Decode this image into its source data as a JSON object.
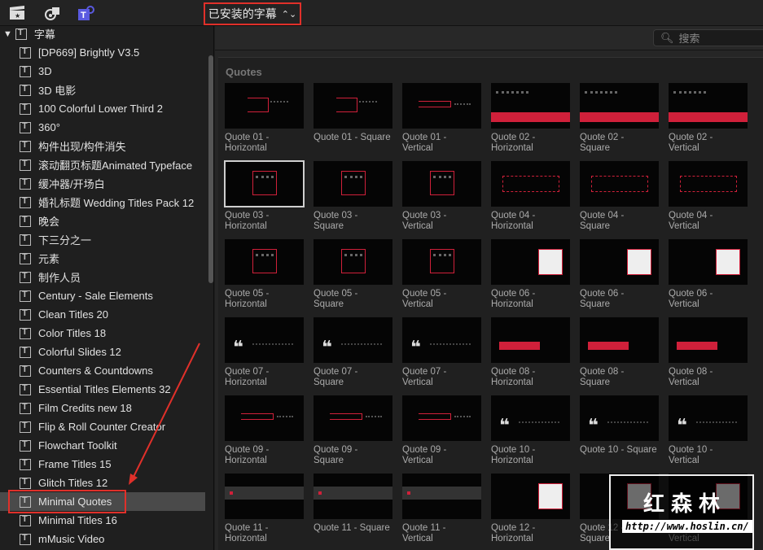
{
  "toolbar": {
    "picker_label": "已安装的字幕",
    "icons": [
      "clapper-icon",
      "music-photo-icon",
      "titles-icon"
    ]
  },
  "sidebar": {
    "root": "字幕",
    "items": [
      "[DP669] Brightly V3.5",
      "3D",
      "3D 电影",
      "100 Colorful Lower Third 2",
      "360°",
      "构件出现/构件消失",
      "滚动翻页标题Animated Typeface",
      "缓冲器/开场白",
      "婚礼标题 Wedding Titles Pack 12",
      "晚会",
      "下三分之一",
      "元素",
      "制作人员",
      "Century - Sale Elements",
      "Clean Titles 20",
      "Color Titles 18",
      "Colorful Slides 12",
      "Counters & Countdowns",
      "Essential Titles Elements 32",
      "Film Credits new 18",
      "Flip & Roll Counter Creator",
      "Flowchart Toolkit",
      "Frame Titles 15",
      "Glitch Titles 12",
      "Minimal Quotes",
      "Minimal Titles 16",
      "mMusic Video"
    ],
    "selected_index": 24
  },
  "search": {
    "placeholder": "搜索"
  },
  "browser": {
    "section": "Quotes",
    "items": [
      {
        "title": "Quote 01 -\nHorizontal",
        "thumb": "frame"
      },
      {
        "title": "Quote 01 - Square",
        "thumb": "frame"
      },
      {
        "title": "Quote 01 -\nVertical",
        "thumb": "line"
      },
      {
        "title": "Quote 02 -\nHorizontal",
        "thumb": "bar"
      },
      {
        "title": "Quote 02 -\nSquare",
        "thumb": "bar"
      },
      {
        "title": "Quote 02 -\nVertical",
        "thumb": "bar"
      },
      {
        "title": "Quote 03 -\nHorizontal",
        "thumb": "box",
        "selected": true
      },
      {
        "title": "Quote 03 -\nSquare",
        "thumb": "box"
      },
      {
        "title": "Quote 03 -\nVertical",
        "thumb": "box"
      },
      {
        "title": "Quote 04 -\nHorizontal",
        "thumb": "corners"
      },
      {
        "title": "Quote 04 -\nSquare",
        "thumb": "corners"
      },
      {
        "title": "Quote 04 -\nVertical",
        "thumb": "corners"
      },
      {
        "title": "Quote 05 -\nHorizontal",
        "thumb": "box"
      },
      {
        "title": "Quote 05 -\nSquare",
        "thumb": "box"
      },
      {
        "title": "Quote 05 -\nVertical",
        "thumb": "box"
      },
      {
        "title": "Quote 06 -\nHorizontal",
        "thumb": "card"
      },
      {
        "title": "Quote 06 -\nSquare",
        "thumb": "card"
      },
      {
        "title": "Quote 06 -\nVertical",
        "thumb": "card"
      },
      {
        "title": "Quote 07 -\nHorizontal",
        "thumb": "quote"
      },
      {
        "title": "Quote 07 -\nSquare",
        "thumb": "quote"
      },
      {
        "title": "Quote 07 -\nVertical",
        "thumb": "quote"
      },
      {
        "title": "Quote 08 -\nHorizontal",
        "thumb": "redbar"
      },
      {
        "title": "Quote 08 -\nSquare",
        "thumb": "redbar"
      },
      {
        "title": "Quote 08 -\nVertical",
        "thumb": "redbar"
      },
      {
        "title": "Quote 09 -\nHorizontal",
        "thumb": "line"
      },
      {
        "title": "Quote 09 -\nSquare",
        "thumb": "line"
      },
      {
        "title": "Quote 09 -\nVertical",
        "thumb": "line"
      },
      {
        "title": "Quote 10 -\nHorizontal",
        "thumb": "quote"
      },
      {
        "title": "Quote 10 - Square",
        "thumb": "quote"
      },
      {
        "title": "Quote 10 -\nVertical",
        "thumb": "quote"
      },
      {
        "title": "Quote 11 -\nHorizontal",
        "thumb": "band"
      },
      {
        "title": "Quote 11 - Square",
        "thumb": "band"
      },
      {
        "title": "Quote 11 -\nVertical",
        "thumb": "band"
      },
      {
        "title": "Quote 12 -\nHorizontal",
        "thumb": "card"
      },
      {
        "title": "Quote 12 -\nSquare",
        "thumb": "card"
      },
      {
        "title": "Quote 12 -\nVertical",
        "thumb": "card"
      }
    ]
  },
  "watermark": {
    "name": "红森林",
    "url": "http://www.hoslin.cn/"
  },
  "colors": {
    "accent_red": "#e0302a",
    "thumb_red": "#d0203a"
  }
}
